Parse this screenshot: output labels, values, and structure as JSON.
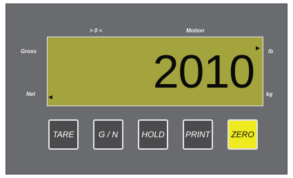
{
  "indicator": {
    "reading": "2010",
    "labels": {
      "above_zero": "> 0 <",
      "motion": "Motion",
      "gross": "Gross",
      "net": "Net",
      "lb": "lb",
      "kg": "kg"
    },
    "active_annunciators": [
      "lb",
      "net"
    ]
  },
  "keys": {
    "tare": "TARE",
    "gross_net": "G / N",
    "hold": "HOLD",
    "print": "PRINT",
    "zero": "ZERO"
  },
  "colors": {
    "panel": "#6a6b6e",
    "lcd": "#a4a43e",
    "key": "#4b4b4d",
    "zero_key": "#f0ea20"
  }
}
